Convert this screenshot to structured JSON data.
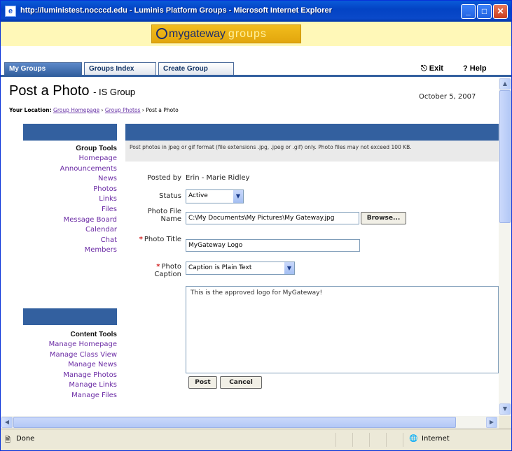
{
  "window": {
    "title": "http://luministest.nocccd.edu - Luminis Platform Groups - Microsoft Internet Explorer",
    "minimize": "_",
    "maximize": "□",
    "close": "✕"
  },
  "banner": {
    "logo_main": "mygateway",
    "logo_sub": "groups"
  },
  "tabs": [
    {
      "label": "My Groups",
      "active": true
    },
    {
      "label": "Groups Index",
      "active": false
    },
    {
      "label": "Create Group",
      "active": false
    }
  ],
  "toplinks": {
    "exit": "Exit",
    "help": "Help"
  },
  "page": {
    "title": "Post a Photo",
    "group": "- IS Group",
    "date": "October 5, 2007",
    "location_label": "Your Location:",
    "crumbs": [
      "Group Homepage",
      "Group Photos"
    ],
    "current_crumb": "Post a Photo"
  },
  "sidebar": {
    "group_tools_title": "Group Tools",
    "group_tools": [
      "Homepage",
      "Announcements",
      "News",
      "Photos",
      "Links",
      "Files",
      "Message Board",
      "Calendar",
      "Chat",
      "Members"
    ],
    "content_tools_title": "Content Tools",
    "content_tools": [
      "Manage Homepage",
      "Manage Class View",
      "Manage News",
      "Manage Photos",
      "Manage Links",
      "Manage Files"
    ]
  },
  "form": {
    "intro": "Post photos in jpeg or gif format (file extensions .jpg, .jpeg or .gif) only. Photo files may not exceed 100 KB.",
    "posted_by_label": "Posted by",
    "posted_by_value": "Erin - Marie Ridley",
    "status_label": "Status",
    "status_value": "Active",
    "file_label": "Photo File Name",
    "file_value": "C:\\My Documents\\My Pictures\\My Gateway.jpg",
    "browse": "Browse...",
    "photo_title_label": "Photo Title",
    "photo_title_value": "MyGateway Logo",
    "caption_label": "Photo Caption",
    "caption_format": "Caption is Plain Text",
    "caption_text": "This is the approved logo for MyGateway!",
    "post_button": "Post",
    "cancel_button": "Cancel"
  },
  "statusbar": {
    "left": "Done",
    "zone": "Internet"
  }
}
